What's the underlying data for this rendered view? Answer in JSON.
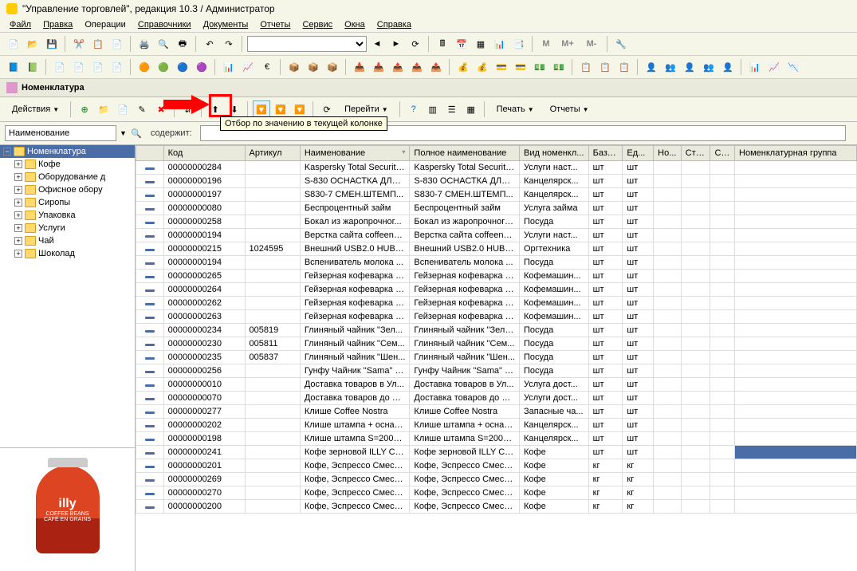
{
  "title": "\"Управление торговлей\", редакция 10.3 / Администратор",
  "menu": [
    "Файл",
    "Правка",
    "Операции",
    "Справочники",
    "Документы",
    "Отчеты",
    "Сервис",
    "Окна",
    "Справка"
  ],
  "mtext": {
    "m": "M",
    "mp": "M+",
    "mm": "M-"
  },
  "subheader": "Номенклатура",
  "actions": {
    "label": "Действия",
    "goto": "Перейти",
    "print": "Печать",
    "reports": "Отчеты"
  },
  "tooltip": "Отбор по значению в текущей колонке",
  "filter": {
    "field": "Наименование",
    "contains_label": "содержит:"
  },
  "tree": {
    "root": "Номенклатура",
    "items": [
      "Кофе",
      "Оборудование д",
      "Офисное обору",
      "Сиропы",
      "Упаковка",
      "Услуги",
      "Чай",
      "Шоколад"
    ]
  },
  "prod": {
    "brand": "illy",
    "l1": "COFFEE BEANS",
    "l2": "CAFÉ EN GRAINS"
  },
  "columns": [
    "",
    "Код",
    "Артикул",
    "Наименование",
    "Полное наименование",
    "Вид номенкл...",
    "Базо...",
    "Ед...",
    "Но...",
    "Стр...",
    "Ст...",
    "Номенклатурная группа"
  ],
  "rows": [
    {
      "code": "00000000284",
      "art": "",
      "name": "Kaspersky Total Security ...",
      "full": "Kaspersky Total Security ...",
      "kind": "Услуги наст...",
      "b": "шт",
      "e": "шт"
    },
    {
      "code": "00000000196",
      "art": "",
      "name": "S-830 ОСНАСТКА ДЛЯ ...",
      "full": "S-830 ОСНАСТКА ДЛЯ ...",
      "kind": "Канцелярск...",
      "b": "шт",
      "e": "шт"
    },
    {
      "code": "00000000197",
      "art": "",
      "name": "S830-7 СМЕН.ШТЕМП...",
      "full": "S830-7 СМЕН.ШТЕМП...",
      "kind": "Канцелярск...",
      "b": "шт",
      "e": "шт"
    },
    {
      "code": "00000000080",
      "art": "",
      "name": "Беспроцентный займ",
      "full": "Беспроцентный займ",
      "kind": "Услуга займа",
      "b": "шт",
      "e": "шт"
    },
    {
      "code": "00000000258",
      "art": "",
      "name": "Бокал из жаропрочног...",
      "full": "Бокал из жаропрочного...",
      "kind": "Посуда",
      "b": "шт",
      "e": "шт"
    },
    {
      "code": "00000000194",
      "art": "",
      "name": "Верстка сайта coffeeno...",
      "full": "Верстка сайта coffeeno...",
      "kind": "Услуги наст...",
      "b": "шт",
      "e": "шт"
    },
    {
      "code": "00000000215",
      "art": "1024595",
      "name": "Внешний USB2.0 HUB 7...",
      "full": "Внешний USB2.0 HUB 7...",
      "kind": "Оргтехника",
      "b": "шт",
      "e": "шт"
    },
    {
      "code": "00000000194",
      "art": "",
      "name": "Вспениватель молока ...",
      "full": "Вспениватель молока ...",
      "kind": "Посуда",
      "b": "шт",
      "e": "шт"
    },
    {
      "code": "00000000265",
      "art": "",
      "name": "Гейзерная кофеварка \"...",
      "full": "Гейзерная кофеварка \"...",
      "kind": "Кофемашин...",
      "b": "шт",
      "e": "шт"
    },
    {
      "code": "00000000264",
      "art": "",
      "name": "Гейзерная кофеварка \"...",
      "full": "Гейзерная кофеварка \"...",
      "kind": "Кофемашин...",
      "b": "шт",
      "e": "шт"
    },
    {
      "code": "00000000262",
      "art": "",
      "name": "Гейзерная кофеварка \"...",
      "full": "Гейзерная кофеварка \"...",
      "kind": "Кофемашин...",
      "b": "шт",
      "e": "шт"
    },
    {
      "code": "00000000263",
      "art": "",
      "name": "Гейзерная кофеварка \"...",
      "full": "Гейзерная кофеварка \"...",
      "kind": "Кофемашин...",
      "b": "шт",
      "e": "шт"
    },
    {
      "code": "00000000234",
      "art": "005819",
      "name": "Глиняный чайник \"Зел...",
      "full": "Глиняный чайник \"Зеле...",
      "kind": "Посуда",
      "b": "шт",
      "e": "шт"
    },
    {
      "code": "00000000230",
      "art": "005811",
      "name": "Глиняный чайник \"Сем...",
      "full": "Глиняный чайник \"Сем...",
      "kind": "Посуда",
      "b": "шт",
      "e": "шт"
    },
    {
      "code": "00000000235",
      "art": "005837",
      "name": "Глиняный чайник \"Шен...",
      "full": "Глиняный чайник \"Шен...",
      "kind": "Посуда",
      "b": "шт",
      "e": "шт"
    },
    {
      "code": "00000000256",
      "art": "",
      "name": "Гунфу Чайник \"Sama\" 5...",
      "full": "Гунфу Чайник \"Sama\" 5...",
      "kind": "Посуда",
      "b": "шт",
      "e": "шт"
    },
    {
      "code": "00000000010",
      "art": "",
      "name": "Доставка товаров в Ул...",
      "full": "Доставка товаров в Ул...",
      "kind": "Услуга дост...",
      "b": "шт",
      "e": "шт"
    },
    {
      "code": "00000000070",
      "art": "",
      "name": "Доставка товаров до П...",
      "full": "Доставка товаров до П...",
      "kind": "Услуги дост...",
      "b": "шт",
      "e": "шт"
    },
    {
      "code": "00000000277",
      "art": "",
      "name": "Клише Coffee Nostra",
      "full": "Клише Coffee Nostra",
      "kind": "Запасные ча...",
      "b": "шт",
      "e": "шт"
    },
    {
      "code": "00000000202",
      "art": "",
      "name": "Клише штампа + оснас...",
      "full": "Клише штампа + оснас...",
      "kind": "Канцелярск...",
      "b": "шт",
      "e": "шт"
    },
    {
      "code": "00000000198",
      "art": "",
      "name": "Клише штампа S=2000-...",
      "full": "Клише штампа S=2000-...",
      "kind": "Канцелярск...",
      "b": "шт",
      "e": "шт"
    },
    {
      "code": "00000000241",
      "art": "",
      "name": "Кофе зерновой ILLY Ca...",
      "full": "Кофе зерновой ILLY Ca...",
      "kind": "Кофе",
      "b": "шт",
      "e": "шт",
      "sel": true
    },
    {
      "code": "00000000201",
      "art": "",
      "name": "Кофе, Эспрессо Смесь ...",
      "full": "Кофе, Эспрессо Смесь ...",
      "kind": "Кофе",
      "b": "кг",
      "e": "кг"
    },
    {
      "code": "00000000269",
      "art": "",
      "name": "Кофе, Эспрессо Смесь ...",
      "full": "Кофе, Эспрессо Смесь ...",
      "kind": "Кофе",
      "b": "кг",
      "e": "кг"
    },
    {
      "code": "00000000270",
      "art": "",
      "name": "Кофе, Эспрессо Смесь ...",
      "full": "Кофе, Эспрессо Смесь ...",
      "kind": "Кофе",
      "b": "кг",
      "e": "кг"
    },
    {
      "code": "00000000200",
      "art": "",
      "name": "Кофе, Эспрессо Смесь ...",
      "full": "Кофе, Эспрессо Смесь ...",
      "kind": "Кофе",
      "b": "кг",
      "e": "кг"
    }
  ]
}
